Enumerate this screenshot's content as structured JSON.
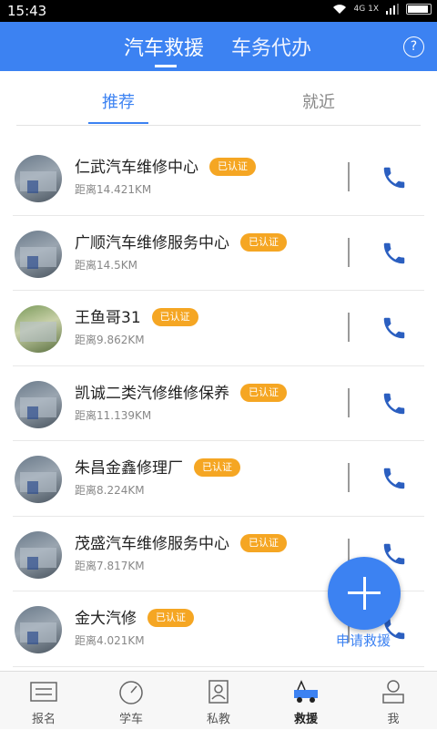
{
  "status_bar": {
    "time": "15:43",
    "net": "4G 1X"
  },
  "header": {
    "tab_active": "汽车救援",
    "tab_other": "车务代办"
  },
  "subtabs": {
    "active": "推荐",
    "inactive": "就近"
  },
  "items": [
    {
      "name": "仁武汽车维修中心",
      "badge": "已认证",
      "distance": "距离14.421KM"
    },
    {
      "name": "广顺汽车维修服务中心",
      "badge": "已认证",
      "distance": "距离14.5KM"
    },
    {
      "name": "王鱼哥31",
      "badge": "已认证",
      "distance": "距离9.862KM"
    },
    {
      "name": "凯诚二类汽修维修保养",
      "badge": "已认证",
      "distance": "距离11.139KM"
    },
    {
      "name": "朱昌金鑫修理厂",
      "badge": "已认证",
      "distance": "距离8.224KM"
    },
    {
      "name": "茂盛汽车维修服务中心",
      "badge": "已认证",
      "distance": "距离7.817KM"
    },
    {
      "name": "金大汽修",
      "badge": "已认证",
      "distance": "距离4.021KM"
    }
  ],
  "fab": {
    "label": "申请救援"
  },
  "bottom_nav": [
    {
      "label": "报名"
    },
    {
      "label": "学车"
    },
    {
      "label": "私教"
    },
    {
      "label": "救援"
    },
    {
      "label": "我"
    }
  ],
  "colors": {
    "primary": "#3c82f2",
    "badge": "#f5a623"
  }
}
